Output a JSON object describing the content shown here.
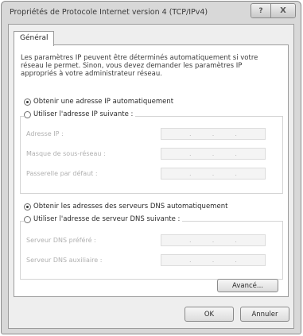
{
  "window": {
    "title": "Propriétés de Protocole Internet version 4 (TCP/IPv4)",
    "help_button": "?",
    "close_button": "X"
  },
  "tab": {
    "label": "Général"
  },
  "description": "Les paramètres IP peuvent être déterminés automatiquement si votre réseau le permet. Sinon, vous devez demander les paramètres IP appropriés à votre administrateur réseau.",
  "ip": {
    "auto_label": "Obtenir une adresse IP automatiquement",
    "auto_selected": true,
    "manual_label": "Utiliser l'adresse IP suivante :",
    "fields": [
      {
        "label": "Adresse IP :",
        "value": ""
      },
      {
        "label": "Masque de sous-réseau :",
        "value": ""
      },
      {
        "label": "Passerelle par défaut :",
        "value": ""
      }
    ]
  },
  "dns": {
    "auto_label": "Obtenir les adresses des serveurs DNS automatiquement",
    "auto_selected": true,
    "manual_label": "Utiliser l'adresse de serveur DNS suivante :",
    "fields": [
      {
        "label": "Serveur DNS préféré :",
        "value": ""
      },
      {
        "label": "Serveur DNS auxiliaire :",
        "value": ""
      }
    ]
  },
  "buttons": {
    "advanced": "Avancé...",
    "ok": "OK",
    "cancel": "Annuler"
  }
}
